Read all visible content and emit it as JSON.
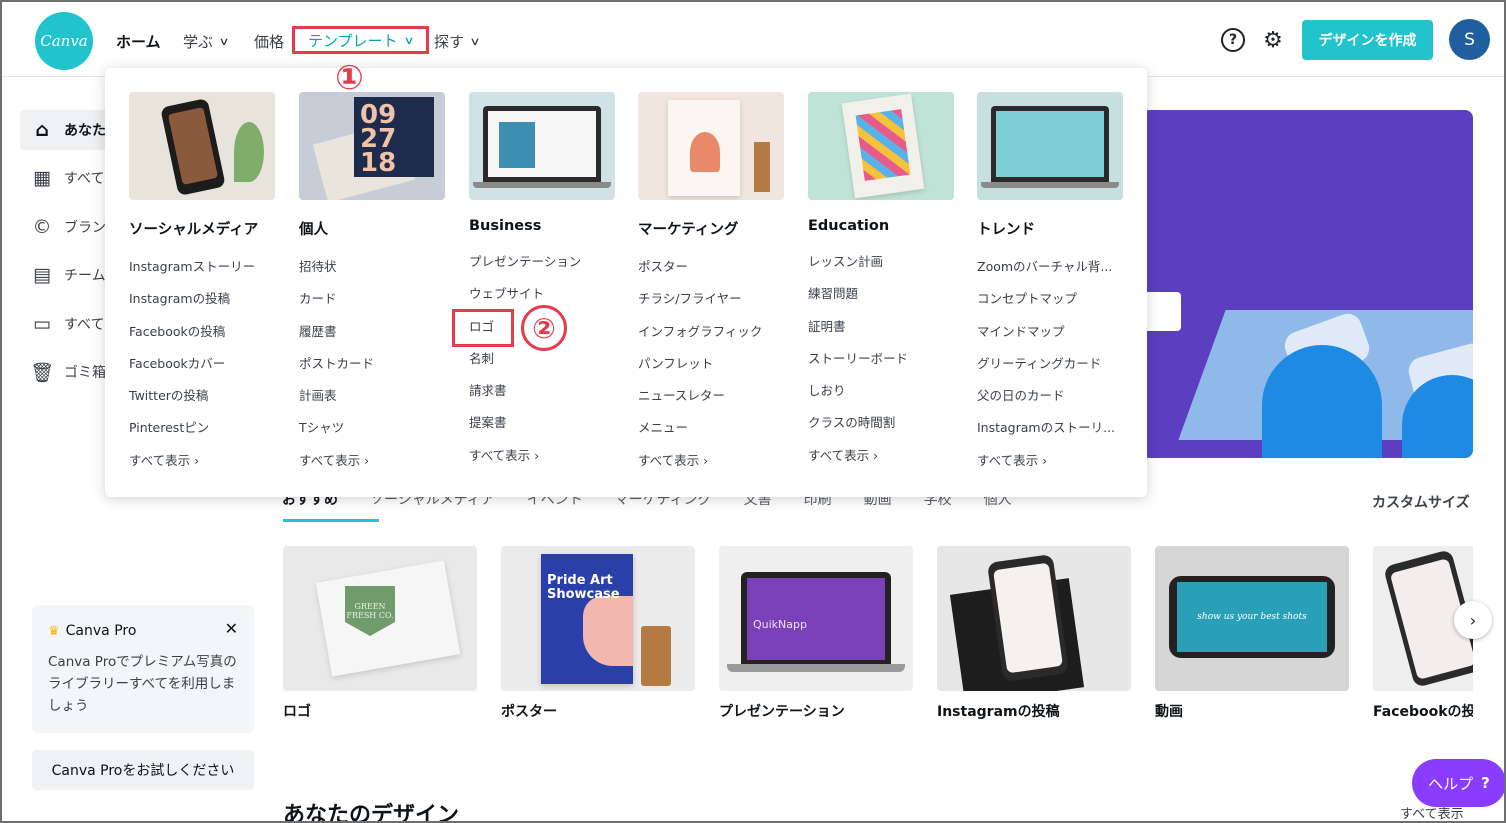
{
  "header": {
    "logo_text": "Canva",
    "nav": {
      "home": "ホーム",
      "learn": "学ぶ",
      "pricing": "価格",
      "templates": "テンプレート",
      "explore": "探す"
    },
    "create_label": "デザインを作成",
    "avatar_letter": "S",
    "help_glyph": "?"
  },
  "annotations": {
    "one": "①",
    "two": "②"
  },
  "sidebar": {
    "items": [
      {
        "label": "あなた",
        "icon": "home-icon"
      },
      {
        "label": "すべて",
        "icon": "grid-icon"
      },
      {
        "label": "ブラン",
        "icon": "brand-icon"
      },
      {
        "label": "チーム",
        "icon": "team-icon"
      },
      {
        "label": "すべて",
        "icon": "folder-icon"
      },
      {
        "label": "ゴミ箱",
        "icon": "trash-icon"
      }
    ],
    "pro_card": {
      "title": "Canva Pro",
      "text": "Canva Proでプレミアム写真のライブラリーすべてを利用しましょう",
      "close": "✕"
    },
    "pro_button": "Canva Proをお試しください"
  },
  "dropdown": {
    "columns": [
      {
        "title": "ソーシャルメディア",
        "items": [
          "Instagramストーリー",
          "Instagramの投稿",
          "Facebookの投稿",
          "Facebookカバー",
          "Twitterの投稿",
          "Pinterestピン"
        ],
        "see_all": "すべて表示",
        "image_art": [
          "phone",
          "#e8e4dc"
        ]
      },
      {
        "title": "個人",
        "items": [
          "招待状",
          "カード",
          "履歴書",
          "ポストカード",
          "計画表",
          "Tシャツ"
        ],
        "see_all": "すべて表示",
        "image_art": [
          "card",
          "#c6cdd6"
        ]
      },
      {
        "title": "Business",
        "items": [
          "プレゼンテーション",
          "ウェブサイト",
          "ロゴ",
          "名刺",
          "請求書",
          "提案書"
        ],
        "see_all": "すべて表示",
        "image_art": [
          "laptop",
          "#cfe3e6"
        ]
      },
      {
        "title": "マーケティング",
        "items": [
          "ポスター",
          "チラシ/フライヤー",
          "インフォグラフィック",
          "パンフレット",
          "ニュースレター",
          "メニュー"
        ],
        "see_all": "すべて表示",
        "image_art": [
          "poster",
          "#f1e6df"
        ]
      },
      {
        "title": "Education",
        "items": [
          "レッスン計画",
          "練習問題",
          "証明書",
          "ストーリーボード",
          "しおり",
          "クラスの時間割"
        ],
        "see_all": "すべて表示",
        "image_art": [
          "book",
          "#bfe3d6"
        ]
      },
      {
        "title": "トレンド",
        "items": [
          "Zoomのバーチャル背...",
          "コンセプトマップ",
          "マインドマップ",
          "グリーティングカード",
          "父の日のカード",
          "Instagramのストーリ..."
        ],
        "see_all": "すべて表示",
        "image_art": [
          "laptop",
          "#c6dfdf"
        ]
      }
    ]
  },
  "tabs": {
    "items": [
      "おすすめ",
      "ソーシャルメディア",
      "イベント",
      "マーケティング",
      "文書",
      "印刷",
      "動画",
      "学校",
      "個人"
    ],
    "custom_size": "カスタムサイズ"
  },
  "cards": [
    {
      "label": "ロゴ",
      "thumb_color": "#e9e9e9"
    },
    {
      "label": "ポスター",
      "thumb_color": "#ececec"
    },
    {
      "label": "プレゼンテーション",
      "thumb_color": "#efefef"
    },
    {
      "label": "Instagramの投稿",
      "thumb_color": "#e7e7e7"
    },
    {
      "label": "動画",
      "thumb_color": "#d6d6d6"
    },
    {
      "label": "Facebookの投稿",
      "thumb_color": "#eeeeee"
    }
  ],
  "thumb_texts": {
    "logo": "GREEN FRESH CO.",
    "poster": "Pride Art Showcase",
    "presentation": "QuikNapp",
    "video": "show us your best shots"
  },
  "section": {
    "title": "あなたのデザイン",
    "see_all": "すべて表示"
  },
  "help_pill": {
    "label": "ヘルプ",
    "glyph": "?"
  },
  "colors": {
    "accent": "#21c4cc",
    "annotation": "#e63c4c",
    "help": "#8b3dff",
    "hero": "#5b3fc0"
  }
}
